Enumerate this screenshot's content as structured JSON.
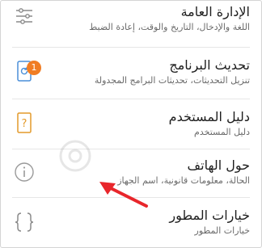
{
  "settings": {
    "items": [
      {
        "title": "الإدارة العامة",
        "subtitle": "اللغة والإدخال، التاريخ والوقت، إعادة الضبط",
        "icon": "sliders-icon"
      },
      {
        "title": "تحديث البرنامج",
        "subtitle": "تنزيل التحديثات، تحديثات البرامج المجدولة",
        "icon": "software-update-icon",
        "badge": "1"
      },
      {
        "title": "دليل المستخدم",
        "subtitle": "دليل المستخدم",
        "icon": "user-manual-icon"
      },
      {
        "title": "حول الهاتف",
        "subtitle": "الحالة، معلومات قانونية، اسم الجهاز",
        "icon": "info-icon"
      },
      {
        "title": "خيارات المطور",
        "subtitle": "خيارات المطور",
        "icon": "developer-braces-icon"
      }
    ],
    "accent_color": "#f07d24",
    "arrow_color": "#e8262b"
  }
}
